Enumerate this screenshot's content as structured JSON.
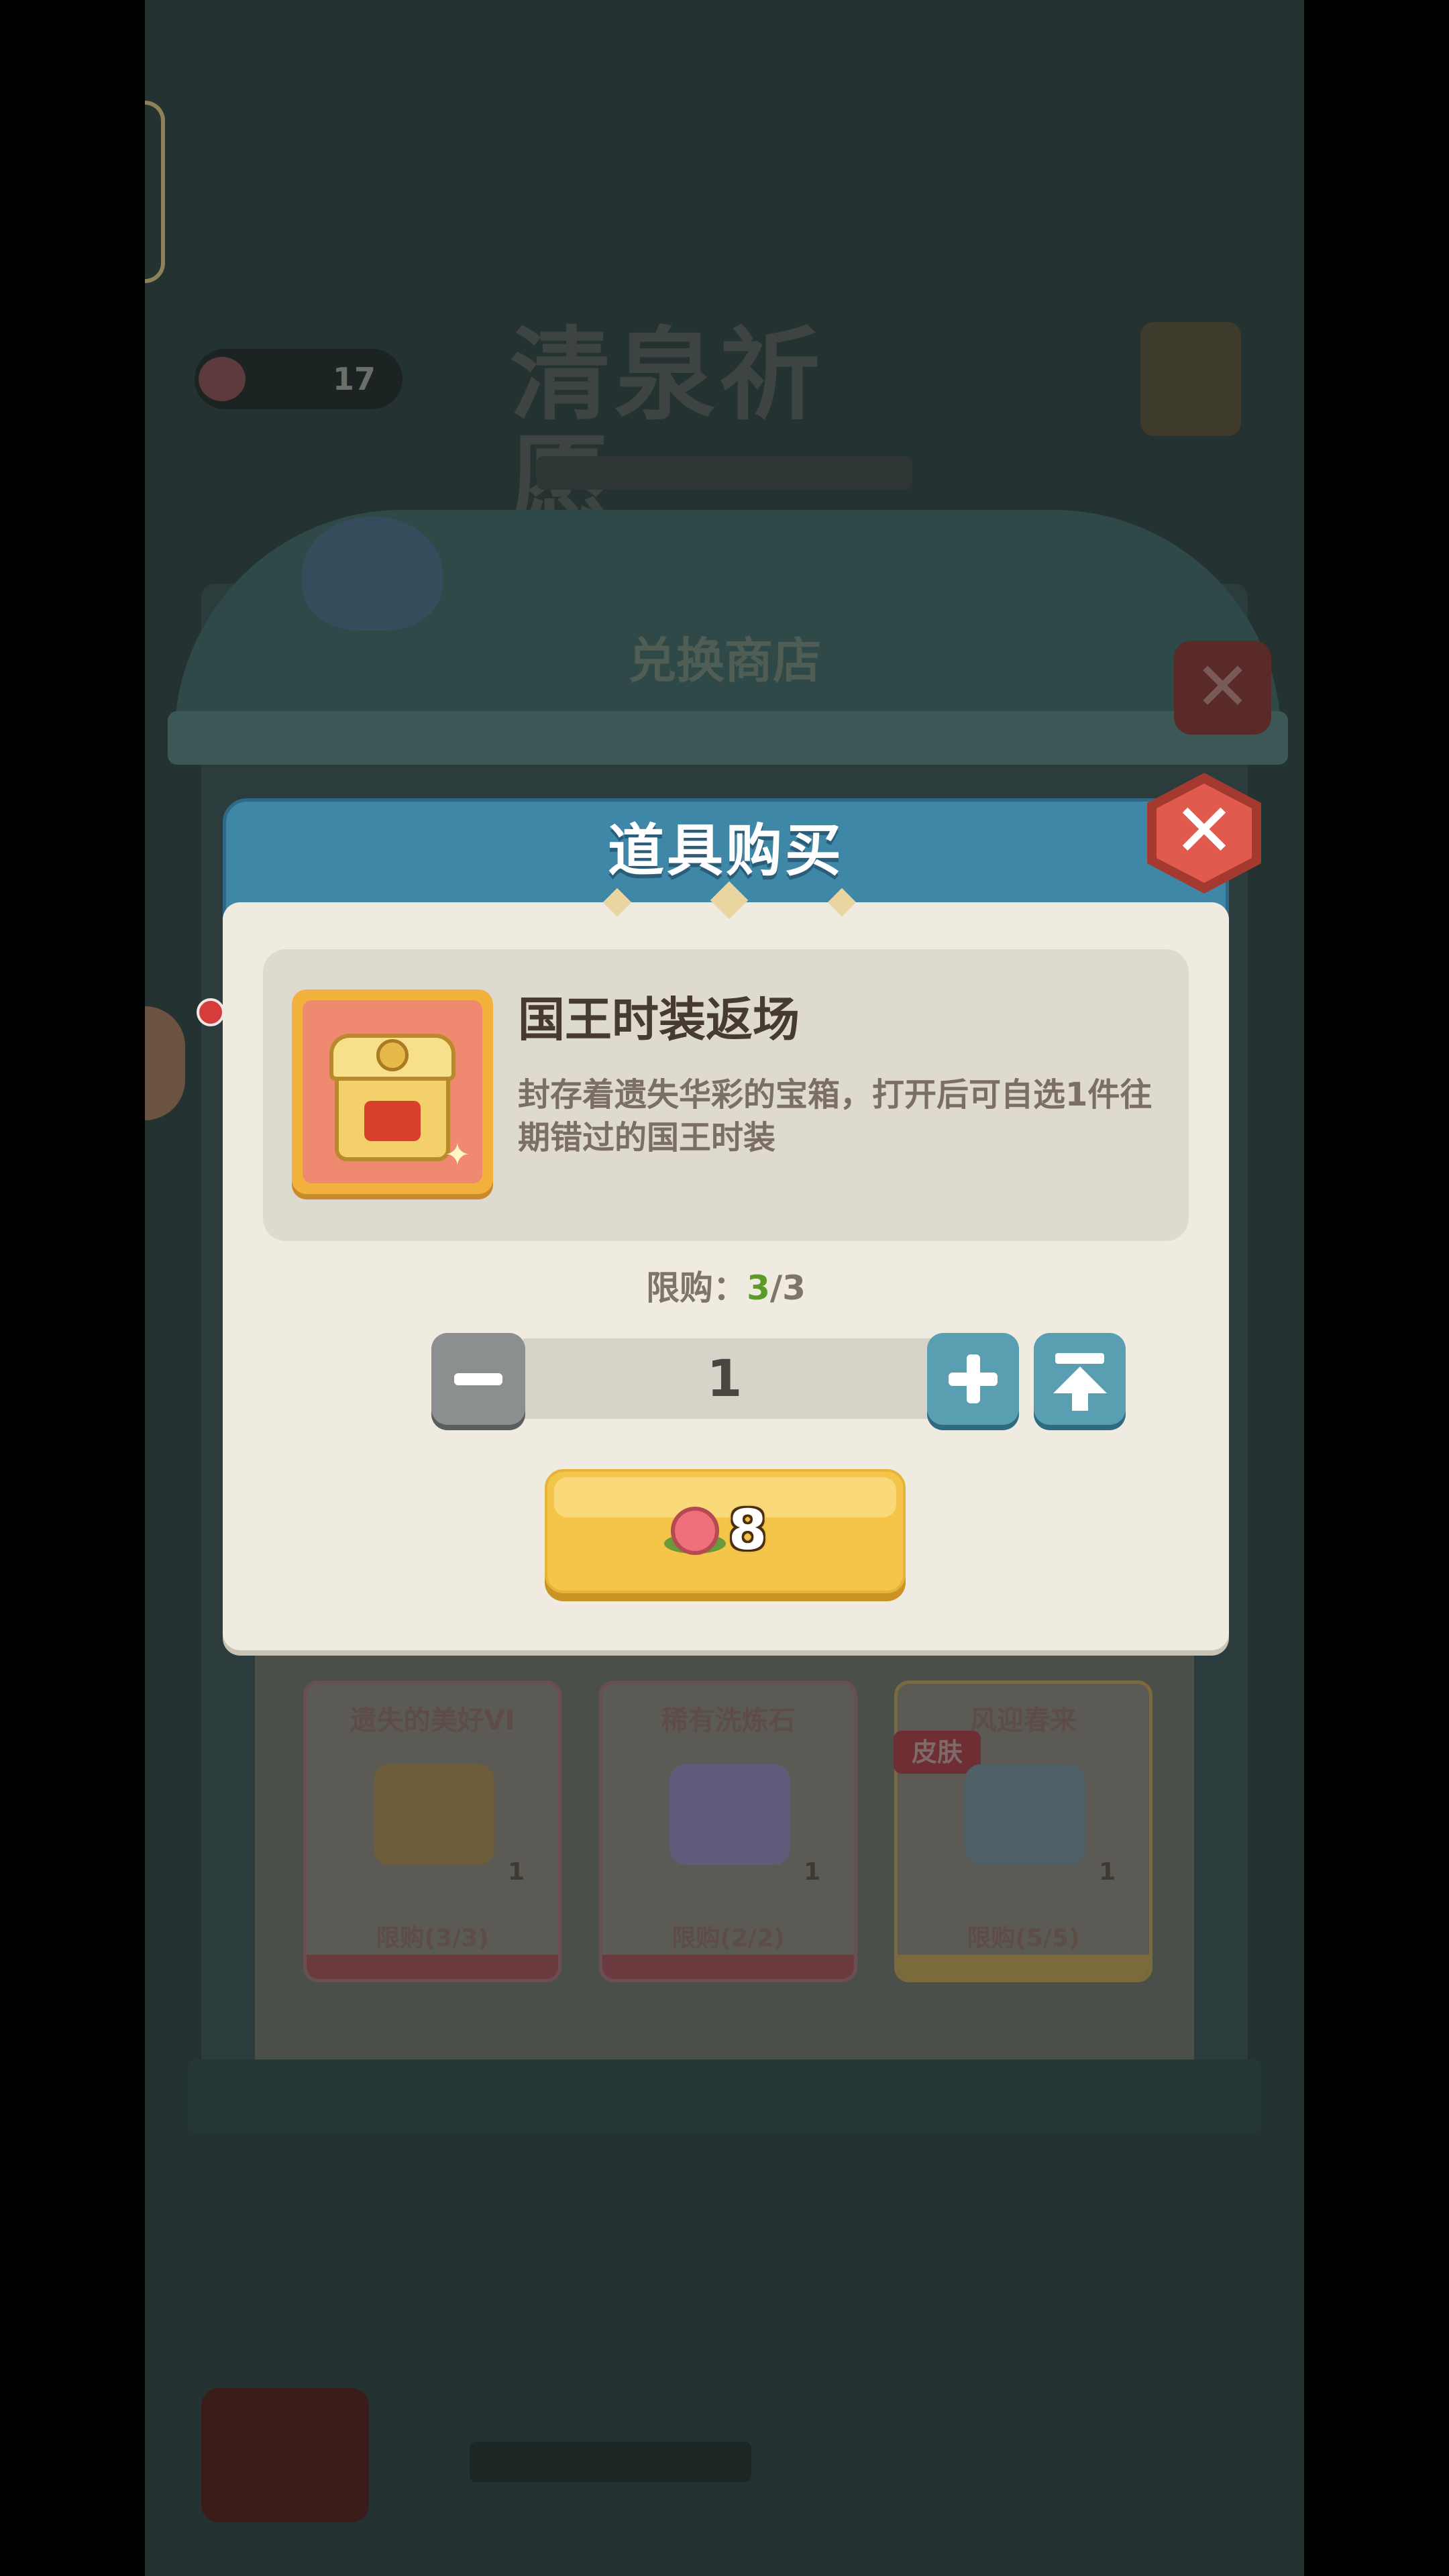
{
  "background": {
    "currency_count": "17",
    "screen_title": "清泉祈愿",
    "shop_title": "兑换商店",
    "shop_items": [
      {
        "name": "遗失的美好VI",
        "qty": "1",
        "limit": "限购(3/3)",
        "tag": ""
      },
      {
        "name": "稀有洗炼石",
        "qty": "1",
        "limit": "限购(2/2)",
        "tag": ""
      },
      {
        "name": "风迎春来",
        "qty": "1",
        "limit": "限购(5/5)",
        "tag": "皮肤"
      }
    ]
  },
  "modal": {
    "title": "道具购买",
    "close_icon": "close-icon",
    "item": {
      "icon": "treasure-chest-icon",
      "name": "国王时装返场",
      "description": "封存着遗失华彩的宝箱，打开后可自选1件往期错过的国王时装"
    },
    "limit": {
      "label": "限购：",
      "current": "3",
      "separator": "/",
      "max": "3"
    },
    "quantity": {
      "value": "1",
      "decrease_icon": "minus-icon",
      "increase_icon": "plus-icon",
      "max_icon": "max-arrow-icon"
    },
    "buy_button": {
      "currency_icon": "flower-gem-icon",
      "price": "8"
    }
  },
  "colors": {
    "header_blue": "#3f87a7",
    "panel_cream": "#efebe1",
    "button_gold": "#f4c548",
    "button_teal": "#5a9eb1",
    "close_red": "#e05a4e",
    "limit_green": "#5c9a2a"
  }
}
